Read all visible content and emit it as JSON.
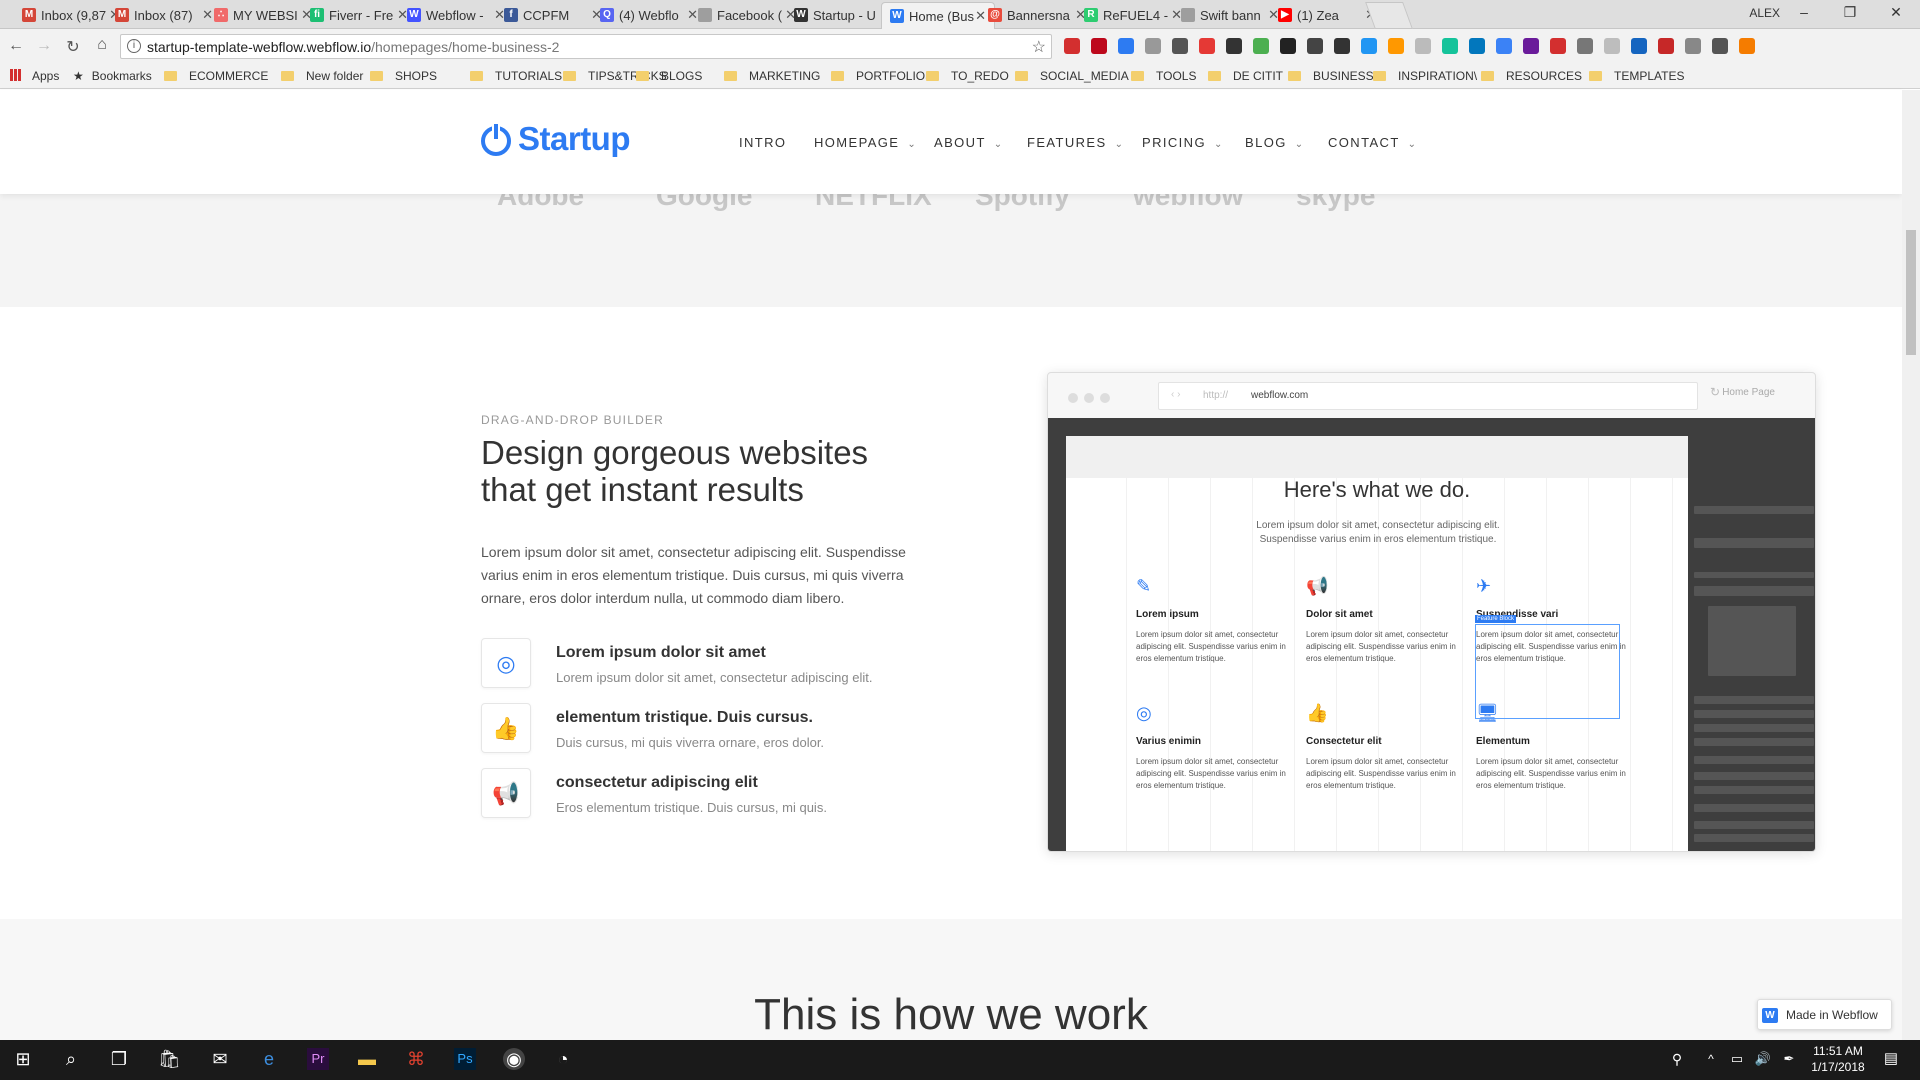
{
  "browser": {
    "tabs": [
      {
        "title": "Inbox (9,87",
        "icon": "gmail-icon",
        "color": "#d44638",
        "glyph": "M"
      },
      {
        "title": "Inbox (87)",
        "icon": "gmail-icon",
        "color": "#d44638",
        "glyph": "M"
      },
      {
        "title": "MY WEBSI",
        "icon": "asana-icon",
        "color": "#f06a6a",
        "glyph": "∴"
      },
      {
        "title": "Fiverr - Fre",
        "icon": "fiverr-icon",
        "color": "#1dbf73",
        "glyph": "fi"
      },
      {
        "title": "Webflow -",
        "icon": "webflow-icon",
        "color": "#4353ff",
        "glyph": "W"
      },
      {
        "title": "CCPFM",
        "icon": "facebook-icon",
        "color": "#3b5998",
        "glyph": "f"
      },
      {
        "title": "(4) Webflo",
        "icon": "forum-icon",
        "color": "#5865f2",
        "glyph": "Q"
      },
      {
        "title": "Facebook (",
        "icon": "page-icon",
        "color": "#9e9e9e",
        "glyph": ""
      },
      {
        "title": "Startup - U",
        "icon": "webflow-icon",
        "color": "#333333",
        "glyph": "W"
      },
      {
        "title": "Home (Bus",
        "icon": "webflow-icon",
        "color": "#2d7bf2",
        "glyph": "W"
      },
      {
        "title": "Bannersna",
        "icon": "bannersnack-icon",
        "color": "#e84c3d",
        "glyph": "@"
      },
      {
        "title": "ReFUEL4 -",
        "icon": "refuel-icon",
        "color": "#2ecc71",
        "glyph": "R"
      },
      {
        "title": "Swift bann",
        "icon": "page-icon",
        "color": "#9e9e9e",
        "glyph": ""
      },
      {
        "title": "(1) Zea",
        "icon": "youtube-icon",
        "color": "#ff0000",
        "glyph": "▶"
      }
    ],
    "active_tab_index": 9,
    "profile_name": "ALEX",
    "window_controls": {
      "minimize": "–",
      "maximize": "❐",
      "close": "✕"
    },
    "url_host": "startup-template-webflow.webflow.io",
    "url_path": "/homepages/home-business-2",
    "bookmarks": [
      "Apps",
      "Bookmarks",
      "ECOMMERCE",
      "New folder",
      "SHOPS",
      "TUTORIALS",
      "TIPS&TRICKS",
      "BLOGS",
      "MARKETING",
      "PORTFOLIOS",
      "TO_REDO",
      "SOCIAL_MEDIA",
      "TOOLS",
      "DE CITIT",
      "BUSINESS",
      "INSPIRATION\\",
      "RESOURCES",
      "TEMPLATES"
    ]
  },
  "site": {
    "brand": "Startup",
    "brand_color": "#2d7bf2",
    "nav": [
      "INTRO",
      "HOMEPAGE",
      "ABOUT",
      "FEATURES",
      "PRICING",
      "BLOG",
      "CONTACT"
    ],
    "partner_logos": [
      "Adobe",
      "Google",
      "NETFLIX",
      "Spotify",
      "webflow",
      "skype"
    ],
    "feature_section": {
      "eyebrow": "DRAG-AND-DROP BUILDER",
      "headline": "Design gorgeous websites that get instant results",
      "intro": "Lorem ipsum dolor sit amet, consectetur adipiscing elit. Suspendisse varius enim in eros elementum tristique. Duis cursus, mi quis viverra ornare, eros dolor interdum nulla, ut commodo diam libero.",
      "items": [
        {
          "icon": "camera-icon",
          "glyph": "◎",
          "title": "Lorem ipsum dolor sit amet",
          "desc": "Lorem ipsum dolor sit amet, consectetur adipiscing elit."
        },
        {
          "icon": "thumbs-up-icon",
          "glyph": "👍",
          "title": "elementum tristique. Duis cursus.",
          "desc": "Duis cursus, mi quis viverra ornare, eros dolor."
        },
        {
          "icon": "megaphone-icon",
          "glyph": "📢",
          "title": "consectetur adipiscing elit",
          "desc": "Eros elementum tristique. Duis cursus, mi quis."
        }
      ]
    },
    "mockup": {
      "scheme": "http://",
      "host": "webflow.com",
      "home_label": "Home Page",
      "canvas_heading": "Here's what we do.",
      "canvas_sub": "Lorem ipsum dolor sit amet, consectetur adipiscing elit. Suspendisse varius enim in eros elementum tristique.",
      "selected_tag": "Feature Block",
      "cards": [
        {
          "icon": "pencil-icon",
          "glyph": "✎",
          "title": "Lorem ipsum"
        },
        {
          "icon": "megaphone-icon",
          "glyph": "📢",
          "title": "Dolor sit amet"
        },
        {
          "icon": "paper-plane-icon",
          "glyph": "✈",
          "title": "Suspendisse vari"
        },
        {
          "icon": "camera-icon",
          "glyph": "◎",
          "title": "Varius enimin"
        },
        {
          "icon": "thumbs-up-icon",
          "glyph": "👍",
          "title": "Consectetur elit"
        },
        {
          "icon": "monitor-icon",
          "glyph": "🖥",
          "title": "Elementum"
        }
      ],
      "card_text": "Lorem ipsum dolor sit amet, consectetur adipiscing elit. Suspendisse varius enim in eros elementum tristique."
    },
    "how_title": "This is how we work",
    "made_in": "Made in Webflow"
  },
  "taskbar": {
    "time": "11:51 AM",
    "date": "1/17/2018"
  }
}
